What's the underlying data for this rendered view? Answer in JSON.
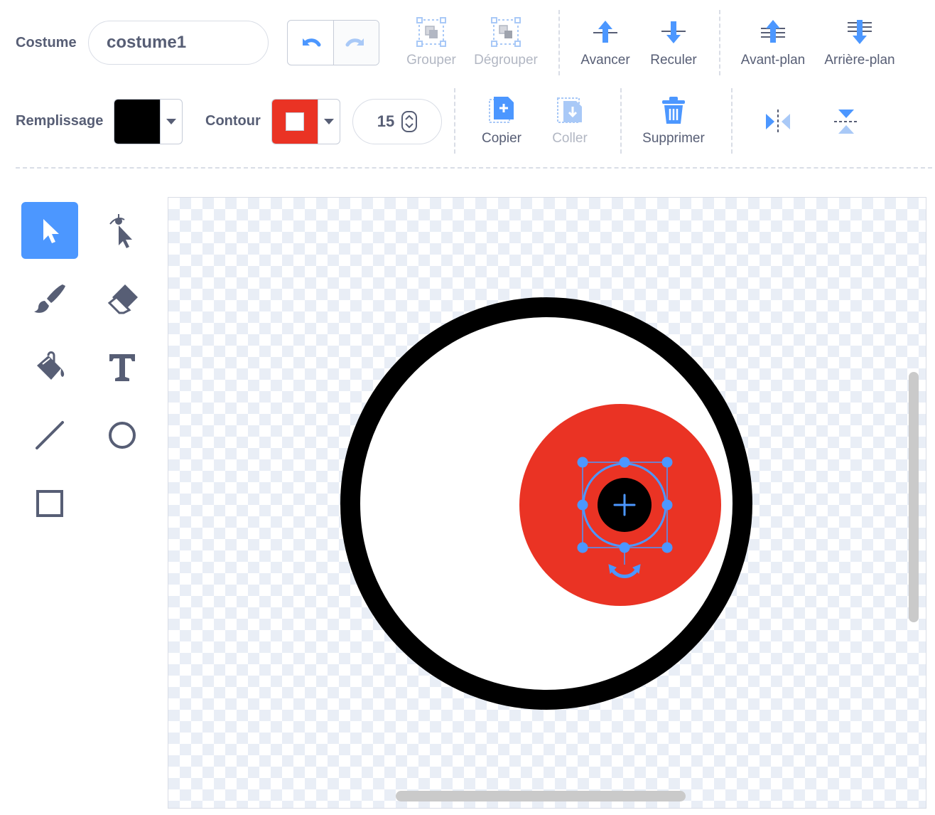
{
  "costume": {
    "label": "Costume",
    "name_value": "costume1"
  },
  "toolbar": {
    "group": "Grouper",
    "ungroup": "Dégrouper",
    "forward": "Avancer",
    "backward": "Reculer",
    "front": "Avant-plan",
    "back": "Arrière-plan",
    "copy": "Copier",
    "paste": "Coller",
    "delete": "Supprimer"
  },
  "fill": {
    "label": "Remplissage",
    "color": "#000000"
  },
  "outline": {
    "label": "Contour",
    "color": "#ea3324",
    "width": "15"
  },
  "tools": [
    "select",
    "reshape",
    "brush",
    "eraser",
    "fill",
    "text",
    "line",
    "circle",
    "rectangle"
  ],
  "colors": {
    "accent": "#4c97ff",
    "text": "#575e75",
    "disabled": "#b2b7c3",
    "red": "#ea3324",
    "black": "#000000"
  }
}
